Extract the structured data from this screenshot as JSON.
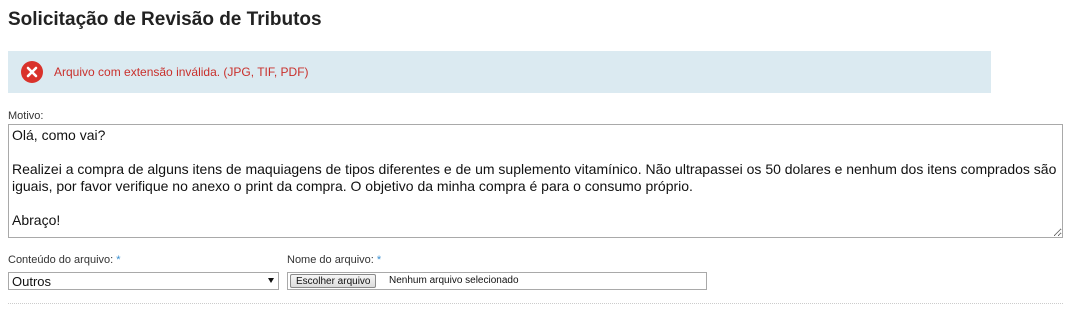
{
  "page": {
    "title": "Solicitação de Revisão de Tributos"
  },
  "alert": {
    "icon": "error-x-icon",
    "color": "#d9322b",
    "message": "Arquivo com extensão inválida. (JPG, TIF, PDF)"
  },
  "form": {
    "motivo": {
      "label": "Motivo:",
      "value": "Olá, como vai?\n\nRealizei a compra de alguns itens de maquiagens de tipos diferentes e de um suplemento vitamínico. Não ultrapassei os 50 dolares e nenhum dos itens comprados são iguais, por favor verifique no anexo o print da compra. O objetivo da minha compra é para o consumo próprio.\n\nAbraço!"
    },
    "conteudo": {
      "label": "Conteúdo do arquivo:",
      "required_mark": "*",
      "selected": "Outros"
    },
    "nome": {
      "label": "Nome do arquivo:",
      "required_mark": "*",
      "button_label": "Escolher arquivo",
      "status": "Nenhum arquivo selecionado"
    }
  }
}
